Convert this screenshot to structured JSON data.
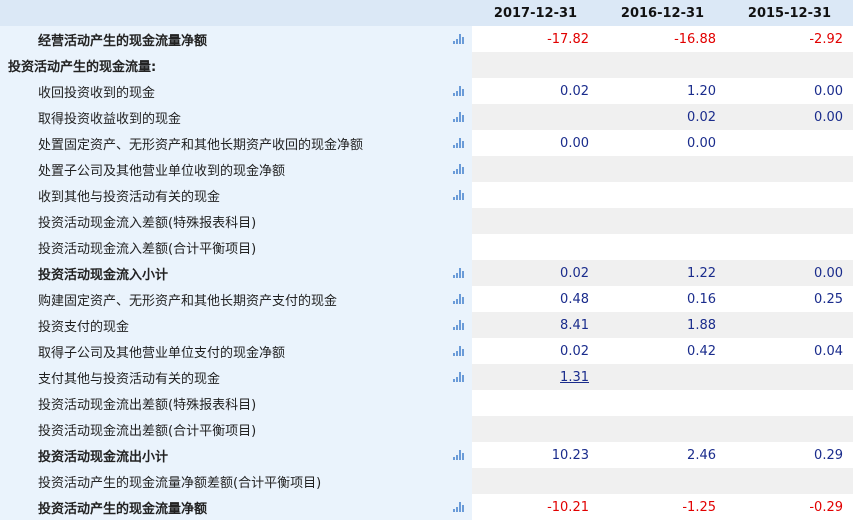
{
  "columns": [
    "2017-12-31",
    "2016-12-31",
    "2015-12-31"
  ],
  "rows": [
    {
      "label": "经营活动产生的现金流量净额",
      "style": "bold-indent",
      "icon": "bar-chart-icon",
      "values": [
        "-17.82",
        "-16.88",
        "-2.92"
      ],
      "neg": [
        true,
        true,
        true
      ]
    },
    {
      "label": "投资活动产生的现金流量:",
      "style": "bold-section",
      "icon": "",
      "values": [
        "",
        "",
        ""
      ]
    },
    {
      "label": "收回投资收到的现金",
      "style": "indent",
      "icon": "bar-chart-icon",
      "values": [
        "0.02",
        "1.20",
        "0.00"
      ]
    },
    {
      "label": "取得投资收益收到的现金",
      "style": "indent",
      "icon": "bar-chart-icon",
      "values": [
        "",
        "0.02",
        "0.00"
      ]
    },
    {
      "label": "处置固定资产、无形资产和其他长期资产收回的现金净额",
      "style": "indent",
      "icon": "bar-chart-icon",
      "values": [
        "0.00",
        "0.00",
        ""
      ]
    },
    {
      "label": "处置子公司及其他营业单位收到的现金净额",
      "style": "indent",
      "icon": "bar-chart-icon",
      "values": [
        "",
        "",
        ""
      ]
    },
    {
      "label": "收到其他与投资活动有关的现金",
      "style": "indent",
      "icon": "bar-chart-icon",
      "values": [
        "",
        "",
        ""
      ]
    },
    {
      "label": "投资活动现金流入差额(特殊报表科目)",
      "style": "indent",
      "icon": "",
      "values": [
        "",
        "",
        ""
      ]
    },
    {
      "label": "投资活动现金流入差额(合计平衡项目)",
      "style": "indent",
      "icon": "",
      "values": [
        "",
        "",
        ""
      ]
    },
    {
      "label": "投资活动现金流入小计",
      "style": "bold-indent",
      "icon": "bar-chart-icon",
      "values": [
        "0.02",
        "1.22",
        "0.00"
      ]
    },
    {
      "label": "购建固定资产、无形资产和其他长期资产支付的现金",
      "style": "indent",
      "icon": "bar-chart-icon",
      "values": [
        "0.48",
        "0.16",
        "0.25"
      ]
    },
    {
      "label": "投资支付的现金",
      "style": "indent",
      "icon": "bar-chart-icon",
      "values": [
        "8.41",
        "1.88",
        ""
      ]
    },
    {
      "label": "取得子公司及其他营业单位支付的现金净额",
      "style": "indent",
      "icon": "bar-chart-icon",
      "values": [
        "0.02",
        "0.42",
        "0.04"
      ]
    },
    {
      "label": "支付其他与投资活动有关的现金",
      "style": "indent",
      "icon": "bar-chart-icon",
      "values": [
        "1.31",
        "",
        ""
      ],
      "link": [
        true,
        false,
        false
      ]
    },
    {
      "label": "投资活动现金流出差额(特殊报表科目)",
      "style": "indent",
      "icon": "",
      "values": [
        "",
        "",
        ""
      ]
    },
    {
      "label": "投资活动现金流出差额(合计平衡项目)",
      "style": "indent",
      "icon": "",
      "values": [
        "",
        "",
        ""
      ]
    },
    {
      "label": "投资活动现金流出小计",
      "style": "bold-indent",
      "icon": "bar-chart-icon",
      "values": [
        "10.23",
        "2.46",
        "0.29"
      ]
    },
    {
      "label": "投资活动产生的现金流量净额差额(合计平衡项目)",
      "style": "indent",
      "icon": "",
      "values": [
        "",
        "",
        ""
      ]
    },
    {
      "label": "投资活动产生的现金流量净额",
      "style": "bold-indent",
      "icon": "bar-chart-icon",
      "values": [
        "-10.21",
        "-1.25",
        "-0.29"
      ],
      "neg": [
        true,
        true,
        true
      ]
    }
  ],
  "colors": {
    "header_bg": "#dbe8f6",
    "label_bg": "#eaf3fc",
    "value_text": "#1a2c8c",
    "negative_text": "#e10000",
    "icon": "#6a9bd8"
  }
}
